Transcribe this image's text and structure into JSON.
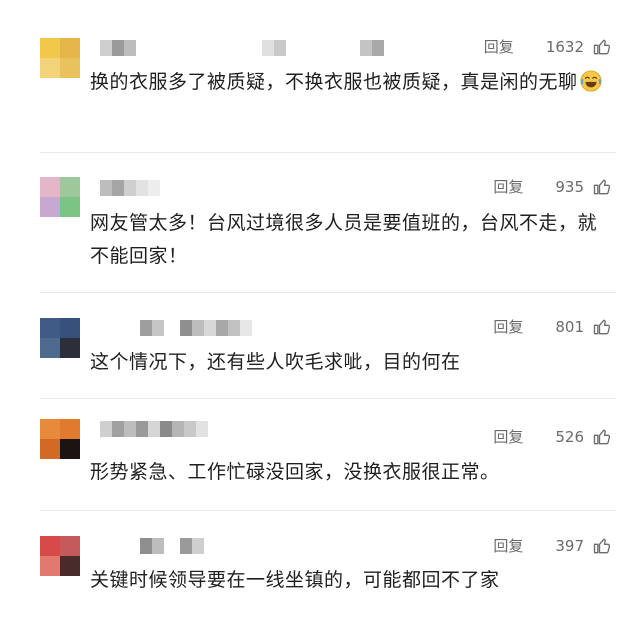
{
  "ui": {
    "reply_label": "回复"
  },
  "comments": [
    {
      "likes": "1632",
      "text": "换的衣服多了被质疑，不换衣服也被质疑，真是闲的无聊",
      "emoji": "laugh-cry-emoji",
      "avatar_colors": [
        "#f2c84a",
        "#e5b64a",
        "#f3d37a",
        "#e9c25d"
      ]
    },
    {
      "likes": "935",
      "text": "网友管太多！台风过境很多人员是要值班的，台风不走，就不能回家！",
      "avatar_colors": [
        "#e3b6c8",
        "#9cc89a",
        "#c7a8d1",
        "#7cc484"
      ]
    },
    {
      "likes": "801",
      "text": "这个情况下，还有些人吹毛求呲，目的何在",
      "avatar_colors": [
        "#3f5b86",
        "#34527b",
        "#4e6a8f",
        "#2a2f3a"
      ]
    },
    {
      "likes": "526",
      "text": "形势紧急、工作忙碌没回家，没换衣服很正常。",
      "avatar_colors": [
        "#e88a3c",
        "#e07a2e",
        "#d06a24",
        "#1c1412"
      ]
    },
    {
      "likes": "397",
      "text": "关键时候领导要在一线坐镇的，可能都回不了家",
      "avatar_colors": [
        "#d84a4a",
        "#c45b5b",
        "#e07a6e",
        "#4a2b2b"
      ]
    }
  ],
  "colors": {
    "text": "#1f1f1f",
    "muted": "#6b6b6b",
    "divider": "#e9e9e9"
  },
  "icons": {
    "like": "thumbs-up-icon"
  }
}
